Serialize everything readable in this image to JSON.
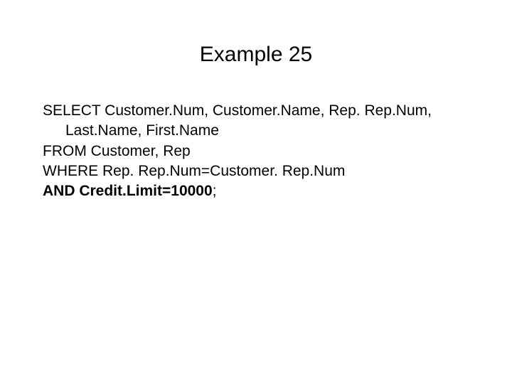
{
  "title": "Example 25",
  "sql": {
    "line1_kw": "SELECT",
    "line1_rest": " Customer.Num, Customer.Name, Rep. Rep.Num,",
    "line2": "Last.Name, First.Name",
    "line3_kw": "FROM",
    "line3_rest": " Customer, Rep",
    "line4_kw": "WHERE",
    "line4_rest": " Rep. Rep.Num=Customer. Rep.Num",
    "line5_bold": "AND Credit.Limit=10000",
    "line5_rest": ";"
  }
}
